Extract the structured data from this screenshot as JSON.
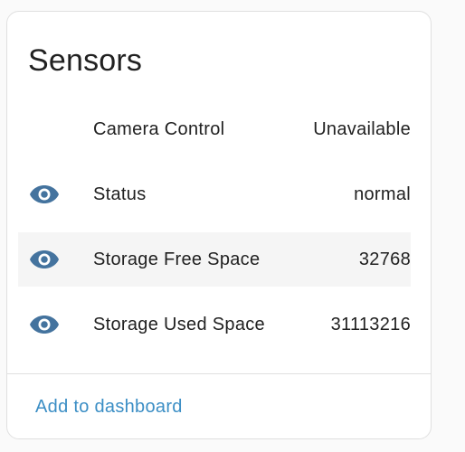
{
  "card": {
    "title": "Sensors",
    "action_label": "Add to dashboard"
  },
  "sensors": [
    {
      "label": "Camera Control",
      "value": "Unavailable",
      "icon": "none"
    },
    {
      "label": "Status",
      "value": "normal",
      "icon": "eye-icon"
    },
    {
      "label": "Storage Free Space",
      "value": "32768",
      "icon": "eye-icon"
    },
    {
      "label": "Storage Used Space",
      "value": "31113216",
      "icon": "eye-icon"
    }
  ],
  "colors": {
    "icon": "#44739e",
    "link": "#3b8ec5",
    "text": "#212121"
  }
}
